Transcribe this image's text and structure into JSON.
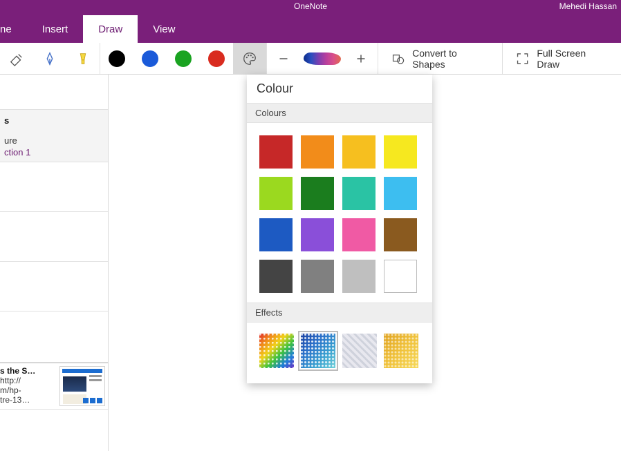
{
  "titlebar": {
    "app": "OneNote",
    "user": "Mehedi Hassan"
  },
  "tabs": {
    "home_partial": "ne",
    "insert": "Insert",
    "draw": "Draw",
    "view": "View",
    "active": "draw"
  },
  "ribbon": {
    "convert": "Convert to Shapes",
    "fullscreen": "Full Screen Draw"
  },
  "sidebar": {
    "header_bold": "s",
    "header_sub": "ure",
    "header_section": "ction 1",
    "note": {
      "title": "s the S…",
      "l1": "http://",
      "l2": "m/hp-",
      "l3": "tre-13…"
    }
  },
  "popup": {
    "title": "Colour",
    "colours_label": "Colours",
    "effects_label": "Effects",
    "colours": [
      {
        "name": "red",
        "hex": "#c62828"
      },
      {
        "name": "orange",
        "hex": "#f28c1a"
      },
      {
        "name": "amber",
        "hex": "#f6bf1f"
      },
      {
        "name": "yellow",
        "hex": "#f6e81f"
      },
      {
        "name": "lime",
        "hex": "#9bd91f"
      },
      {
        "name": "dark-green",
        "hex": "#1b7d1e"
      },
      {
        "name": "teal",
        "hex": "#2ac3a4"
      },
      {
        "name": "sky-blue",
        "hex": "#3dbef0"
      },
      {
        "name": "blue",
        "hex": "#1d5ac2"
      },
      {
        "name": "purple",
        "hex": "#8a4fd9"
      },
      {
        "name": "pink",
        "hex": "#f05aa4"
      },
      {
        "name": "brown",
        "hex": "#8a5a1f"
      },
      {
        "name": "dark-grey",
        "hex": "#444444"
      },
      {
        "name": "grey",
        "hex": "#808080"
      },
      {
        "name": "light-grey",
        "hex": "#bfbfbf"
      },
      {
        "name": "white",
        "hex": "#ffffff"
      }
    ],
    "effects": [
      "rainbow",
      "galaxy",
      "silver",
      "gold"
    ],
    "selected_effect": "galaxy"
  }
}
